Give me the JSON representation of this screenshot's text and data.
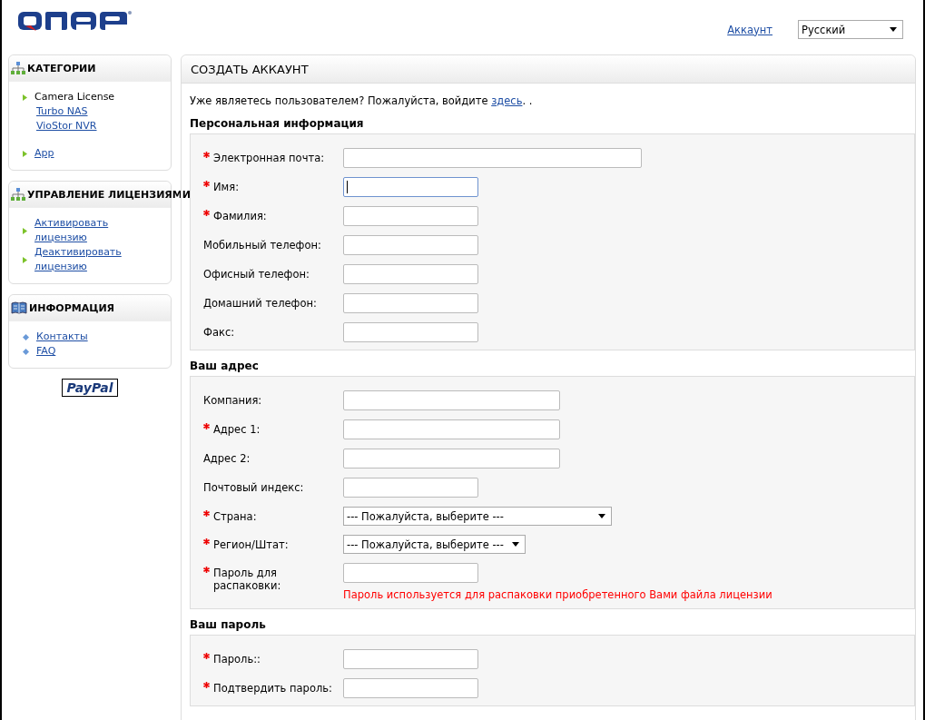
{
  "header": {
    "account_link": "Аккаунт",
    "language": "Русский"
  },
  "sidebar": [
    {
      "title": "КАТЕГОРИИ",
      "items": [
        {
          "label": "Camera License",
          "link": false,
          "children": [
            {
              "label": "Turbo NAS",
              "link": true
            },
            {
              "label": "VioStor NVR",
              "link": true
            }
          ]
        },
        {
          "label": "App",
          "link": true
        }
      ]
    },
    {
      "title": "УПРАВЛЕНИЕ ЛИЦЕНЗИЯМИ",
      "items": [
        {
          "label": "Активировать лицензию",
          "link": true
        },
        {
          "label": "Деактивировать лицензию",
          "link": true
        }
      ]
    },
    {
      "title": "ИНФОРМАЦИЯ",
      "items": [
        {
          "label": "Контакты",
          "link": true
        },
        {
          "label": "FAQ",
          "link": true
        }
      ]
    }
  ],
  "paypal": "PayPal",
  "main": {
    "title": "СОЗДАТЬ АККАУНТ",
    "intro": {
      "text": "Уже являетесь пользователем? Пожалуйста, войдите",
      "link": "здесь",
      "after": ". ."
    },
    "sections": [
      {
        "title": "Персональная информация",
        "fields": [
          {
            "label": "Электронная почта:",
            "required": true,
            "kind": "email",
            "focused": false
          },
          {
            "label": "Имя:",
            "required": true,
            "kind": "short",
            "focused": true
          },
          {
            "label": "Фамилия:",
            "required": true,
            "kind": "short",
            "focused": false
          },
          {
            "label": "Мобильный телефон:",
            "required": false,
            "kind": "short",
            "focused": false
          },
          {
            "label": "Офисный телефон:",
            "required": false,
            "kind": "short",
            "focused": false
          },
          {
            "label": "Домашний телефон:",
            "required": false,
            "kind": "short",
            "focused": false
          },
          {
            "label": "Факс:",
            "required": false,
            "kind": "short",
            "focused": false
          }
        ]
      },
      {
        "title": "Ваш адрес",
        "fields": [
          {
            "label": "Компания:",
            "required": false,
            "kind": "medium",
            "focused": false
          },
          {
            "label": "Адрес 1:",
            "required": true,
            "kind": "medium",
            "focused": false
          },
          {
            "label": "Адрес 2:",
            "required": false,
            "kind": "medium",
            "focused": false
          },
          {
            "label": "Почтовый индекс:",
            "required": false,
            "kind": "short",
            "focused": false
          },
          {
            "label": "Страна:",
            "required": true,
            "kind": "select-wide",
            "value": "--- Пожалуйста, выберите ---",
            "focused": false
          },
          {
            "label": "Регион/Штат:",
            "required": true,
            "kind": "select",
            "value": "--- Пожалуйста, выберите ---",
            "focused": false
          },
          {
            "label": "Пароль для распаковки:",
            "required": true,
            "kind": "short",
            "hint": "Пароль используется для распаковки приобретенного Вами файла лицензии",
            "focused": false
          }
        ]
      },
      {
        "title": "Ваш пароль",
        "fields": [
          {
            "label": "Пароль::",
            "required": true,
            "kind": "short",
            "focused": false
          },
          {
            "label": "Подтвердить пароль:",
            "required": true,
            "kind": "short",
            "focused": false
          }
        ]
      }
    ]
  }
}
